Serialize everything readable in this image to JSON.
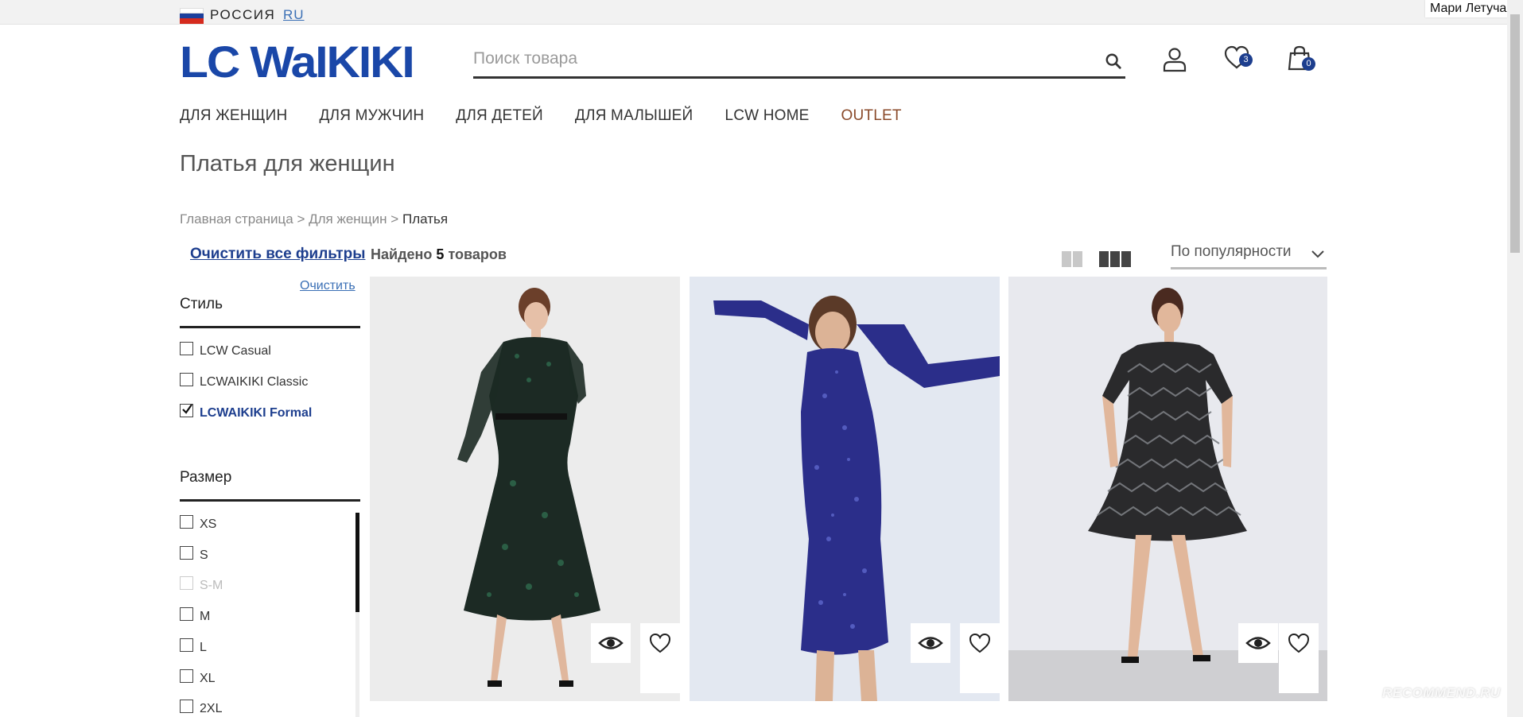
{
  "topbar": {
    "country": "РОССИЯ",
    "lang": "RU",
    "user": "Мари Летучая"
  },
  "header": {
    "logo": "LC WaIKIKI",
    "search_placeholder": "Поиск товара",
    "favorites_count": "3",
    "cart_count": "0"
  },
  "nav": [
    "ДЛЯ ЖЕНЩИН",
    "ДЛЯ МУЖЧИН",
    "ДЛЯ ДЕТЕЙ",
    "ДЛЯ МАЛЫШЕЙ",
    "LCW HOME",
    "OUTLET"
  ],
  "page": {
    "title": "Платья для женщин",
    "breadcrumb": {
      "home": "Главная страница",
      "sep": ">",
      "women": "Для женщин",
      "current": "Платья"
    }
  },
  "toolbar": {
    "clear_all": "Очистить все фильтры",
    "found_prefix": "Найдено",
    "found_count": "5",
    "found_suffix": "товаров",
    "sort_label": "По популярности"
  },
  "filters": {
    "clear": "Очистить",
    "style": {
      "title": "Стиль",
      "options": [
        "LCW Casual",
        "LCWAIKIKI Classic",
        "LCWAIKIKI Formal"
      ],
      "checked": "LCWAIKIKI Formal"
    },
    "size": {
      "title": "Размер",
      "options": [
        "XS",
        "S",
        "S-M",
        "M",
        "L",
        "XL",
        "2XL"
      ],
      "disabled": "S-M"
    }
  },
  "products": [
    {
      "dress_color": "#1c2a24",
      "pattern_color": "#2f6b4e",
      "bg": "#ececec"
    },
    {
      "dress_color": "#2b2e8a",
      "pattern_color": "#5a64c8",
      "bg": "#dfe4ee"
    },
    {
      "dress_color": "#2a2a2c",
      "pattern_color": "#7a7d82",
      "bg": "#e8e9ee"
    }
  ],
  "watermark": "RECOMMEND.RU",
  "icons": [
    "flag-russia-icon",
    "search-icon",
    "user-icon",
    "heart-icon",
    "shopping-bag-icon",
    "eye-icon",
    "chevron-down-icon"
  ]
}
